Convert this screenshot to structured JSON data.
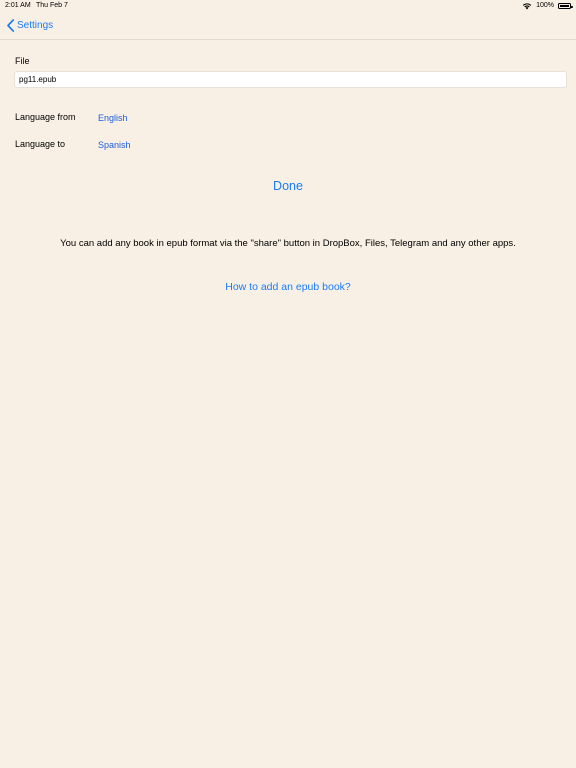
{
  "status_bar": {
    "time": "2:01 AM",
    "date": "Thu Feb 7",
    "battery": "100%",
    "battery_level": 1.0
  },
  "nav": {
    "back_label": "Settings"
  },
  "file": {
    "label": "File",
    "value": "pg11.epub"
  },
  "languages": {
    "from_label": "Language from",
    "from_value": "English",
    "to_label": "Language to",
    "to_value": "Spanish"
  },
  "done_label": "Done",
  "info_text": "You can add any book in epub format via the \"share\" button in DropBox, Files, Telegram and any other apps.",
  "how_link": "How to add an epub book?",
  "colors": {
    "background": "#f8f0e4",
    "accent": "#1a7cf5",
    "link": "#1a5fe0"
  }
}
